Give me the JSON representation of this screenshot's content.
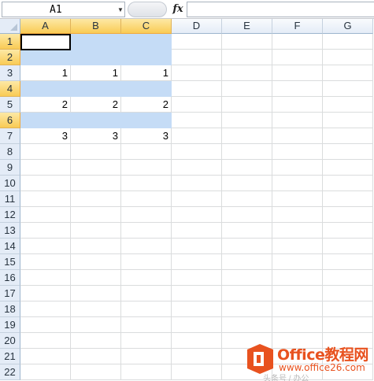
{
  "formula_bar": {
    "name_box": "A1",
    "fx_label": "fx",
    "formula_value": ""
  },
  "columns": [
    "A",
    "B",
    "C",
    "D",
    "E",
    "F",
    "G"
  ],
  "selected_columns": [
    "A",
    "B",
    "C"
  ],
  "rows": [
    "1",
    "2",
    "3",
    "4",
    "5",
    "6",
    "7",
    "8",
    "9",
    "10",
    "11",
    "12",
    "13",
    "14",
    "15",
    "16",
    "17",
    "18",
    "19",
    "20",
    "21",
    "22"
  ],
  "selected_rows": [
    "1",
    "2",
    "4",
    "6"
  ],
  "active_cell": "A1",
  "cells": {
    "3": [
      "1",
      "1",
      "1"
    ],
    "5": [
      "2",
      "2",
      "2"
    ],
    "7": [
      "3",
      "3",
      "3"
    ]
  },
  "highlight_color": "#c5dcf6",
  "watermark": {
    "title": "Office教程网",
    "url": "www.office26.com",
    "sub": "头条号 / 办公"
  }
}
